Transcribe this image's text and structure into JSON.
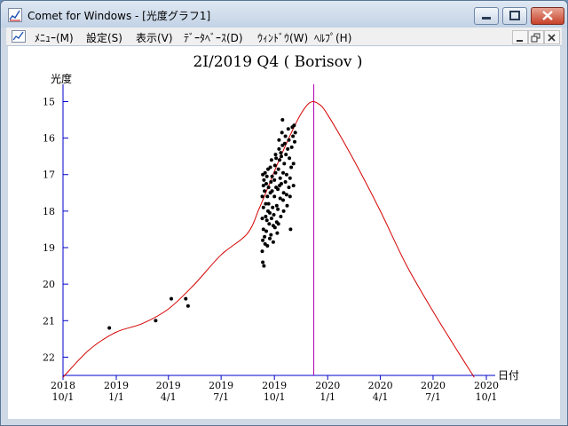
{
  "window": {
    "title": "Comet for Windows - [光度グラフ1]"
  },
  "menu": {
    "items": [
      "ﾒﾆｭｰ(M)",
      "設定(S)",
      "表示(V)",
      "ﾃﾞｰﾀﾍﾞｰｽ(D)",
      "ｳｨﾝﾄﾞｳ(W)",
      "ﾍﾙﾌﾟ(H)"
    ]
  },
  "icons": {
    "app": "comet-graph-icon",
    "minimize": "minimize-icon",
    "maximize": "maximize-icon",
    "close": "close-icon",
    "mdi_minimize": "mdi-minimize-icon",
    "mdi_restore": "mdi-restore-icon",
    "mdi_close": "mdi-close-icon"
  },
  "colors": {
    "curve": "#d40000",
    "perihelion_line": "#b000b0",
    "axis": "#0000cc",
    "points": "#000000"
  },
  "chart_data": {
    "type": "scatter",
    "title": "2I/2019 Q4 ( Borisov )",
    "ylabel": "光度",
    "xlabel": "日付",
    "ylim": [
      22.5,
      14.6
    ],
    "y_inverted": true,
    "y_ticks": [
      15,
      16,
      17,
      18,
      19,
      20,
      21,
      22
    ],
    "x_ticks": [
      {
        "year": "2018",
        "md": "10/1",
        "date": "2018-10-01"
      },
      {
        "year": "2019",
        "md": "1/1",
        "date": "2019-01-01"
      },
      {
        "year": "2019",
        "md": "4/1",
        "date": "2019-04-01"
      },
      {
        "year": "2019",
        "md": "7/1",
        "date": "2019-07-01"
      },
      {
        "year": "2019",
        "md": "10/1",
        "date": "2019-10-01"
      },
      {
        "year": "2020",
        "md": "1/1",
        "date": "2020-01-01"
      },
      {
        "year": "2020",
        "md": "4/1",
        "date": "2020-04-01"
      },
      {
        "year": "2020",
        "md": "7/1",
        "date": "2020-07-01"
      },
      {
        "year": "2020",
        "md": "10/1",
        "date": "2020-10-01"
      }
    ],
    "xlim": [
      "2018-10-01",
      "2020-10-01"
    ],
    "perihelion_date": "2019-12-08",
    "series": [
      {
        "type": "line",
        "points": [
          [
            "2018-10-01",
            22.55
          ],
          [
            "2018-11-15",
            21.8
          ],
          [
            "2018-12-31",
            21.32
          ],
          [
            "2019-02-15",
            21.08
          ],
          [
            "2019-04-01",
            20.68
          ],
          [
            "2019-05-15",
            20.02
          ],
          [
            "2019-07-01",
            19.2
          ],
          [
            "2019-08-15",
            18.62
          ],
          [
            "2019-09-05",
            17.92
          ],
          [
            "2019-09-20",
            17.35
          ],
          [
            "2019-10-06",
            16.72
          ],
          [
            "2019-10-26",
            16.0
          ],
          [
            "2019-11-15",
            15.36
          ],
          [
            "2019-12-01",
            15.03
          ],
          [
            "2019-12-15",
            15.05
          ],
          [
            "2020-01-01",
            15.36
          ],
          [
            "2020-02-15",
            16.6
          ],
          [
            "2020-04-01",
            18.0
          ],
          [
            "2020-05-15",
            19.45
          ],
          [
            "2020-07-01",
            20.75
          ],
          [
            "2020-08-15",
            21.9
          ],
          [
            "2020-09-10",
            22.55
          ]
        ]
      },
      {
        "type": "scatter",
        "points": [
          [
            "2018-12-20",
            21.2
          ],
          [
            "2019-03-10",
            21.0
          ],
          [
            "2019-04-06",
            20.4
          ],
          [
            "2019-05-01",
            20.4
          ],
          [
            "2019-05-05",
            20.6
          ],
          [
            "2019-09-10",
            19.1
          ],
          [
            "2019-09-11",
            19.4
          ],
          [
            "2019-09-13",
            19.5
          ],
          [
            "2019-09-11",
            18.8
          ],
          [
            "2019-09-12",
            18.5
          ],
          [
            "2019-09-14",
            18.7
          ],
          [
            "2019-09-10",
            18.2
          ],
          [
            "2019-09-12",
            17.9
          ],
          [
            "2019-09-10",
            17.6
          ],
          [
            "2019-09-12",
            17.3
          ],
          [
            "2019-09-11",
            17.0
          ],
          [
            "2019-09-13",
            17.15
          ],
          [
            "2019-09-15",
            16.95
          ],
          [
            "2019-09-14",
            17.45
          ],
          [
            "2019-09-16",
            17.8
          ],
          [
            "2019-09-16",
            18.15
          ],
          [
            "2019-09-17",
            18.55
          ],
          [
            "2019-09-18",
            18.25
          ],
          [
            "2019-09-19",
            17.6
          ],
          [
            "2019-09-18",
            17.05
          ],
          [
            "2019-09-20",
            16.85
          ],
          [
            "2019-09-21",
            17.35
          ],
          [
            "2019-09-21",
            17.8
          ],
          [
            "2019-09-22",
            18.35
          ],
          [
            "2019-09-23",
            18.75
          ],
          [
            "2019-09-23",
            18.05
          ],
          [
            "2019-09-24",
            17.5
          ],
          [
            "2019-09-25",
            17.2
          ],
          [
            "2019-09-24",
            16.8
          ],
          [
            "2019-09-26",
            16.6
          ],
          [
            "2019-09-27",
            17.05
          ],
          [
            "2019-09-27",
            17.45
          ],
          [
            "2019-09-28",
            17.9
          ],
          [
            "2019-09-29",
            18.4
          ],
          [
            "2019-09-29",
            18.85
          ],
          [
            "2019-09-30",
            18.1
          ],
          [
            "2019-10-01",
            17.6
          ],
          [
            "2019-10-01",
            17.15
          ],
          [
            "2019-10-02",
            16.75
          ],
          [
            "2019-10-03",
            16.45
          ],
          [
            "2019-10-03",
            16.95
          ],
          [
            "2019-10-04",
            17.35
          ],
          [
            "2019-10-05",
            17.85
          ],
          [
            "2019-10-05",
            18.3
          ],
          [
            "2019-10-06",
            18.6
          ],
          [
            "2019-10-07",
            17.95
          ],
          [
            "2019-10-07",
            17.4
          ],
          [
            "2019-10-08",
            16.85
          ],
          [
            "2019-10-09",
            16.3
          ],
          [
            "2019-10-09",
            16.05
          ],
          [
            "2019-10-10",
            16.6
          ],
          [
            "2019-10-11",
            17.1
          ],
          [
            "2019-10-11",
            17.65
          ],
          [
            "2019-10-12",
            18.15
          ],
          [
            "2019-10-13",
            17.25
          ],
          [
            "2019-10-13",
            16.5
          ],
          [
            "2019-10-14",
            15.85
          ],
          [
            "2019-10-15",
            15.5
          ],
          [
            "2019-10-15",
            16.2
          ],
          [
            "2019-10-16",
            16.95
          ],
          [
            "2019-10-17",
            17.5
          ],
          [
            "2019-10-17",
            18.0
          ],
          [
            "2019-10-18",
            16.7
          ],
          [
            "2019-10-19",
            16.15
          ],
          [
            "2019-10-20",
            15.95
          ],
          [
            "2019-10-21",
            16.45
          ],
          [
            "2019-10-22",
            17.0
          ],
          [
            "2019-10-22",
            17.55
          ],
          [
            "2019-10-23",
            17.85
          ],
          [
            "2019-10-24",
            16.3
          ],
          [
            "2019-10-25",
            15.75
          ],
          [
            "2019-10-26",
            16.05
          ],
          [
            "2019-10-27",
            16.55
          ],
          [
            "2019-10-28",
            17.1
          ],
          [
            "2019-10-28",
            17.6
          ],
          [
            "2019-10-29",
            18.5
          ],
          [
            "2019-10-30",
            16.8
          ],
          [
            "2019-10-31",
            16.25
          ],
          [
            "2019-11-01",
            15.7
          ],
          [
            "2019-11-02",
            15.95
          ],
          [
            "2019-11-03",
            16.7
          ],
          [
            "2019-11-03",
            17.3
          ],
          [
            "2019-11-04",
            15.65
          ],
          [
            "2019-11-05",
            16.1
          ],
          [
            "2019-11-06",
            15.85
          ],
          [
            "2019-09-17",
            17.25
          ],
          [
            "2019-09-20",
            18.0
          ],
          [
            "2019-09-26",
            18.2
          ],
          [
            "2019-10-02",
            18.45
          ],
          [
            "2019-10-04",
            16.55
          ],
          [
            "2019-10-10",
            17.3
          ],
          [
            "2019-10-16",
            17.7
          ],
          [
            "2019-10-20",
            17.2
          ],
          [
            "2019-10-26",
            17.35
          ],
          [
            "2019-09-15",
            18.9
          ],
          [
            "2019-09-19",
            18.95
          ],
          [
            "2019-09-25",
            18.65
          ],
          [
            "2019-10-08",
            18.35
          ],
          [
            "2019-10-12",
            16.4
          ]
        ]
      }
    ]
  }
}
